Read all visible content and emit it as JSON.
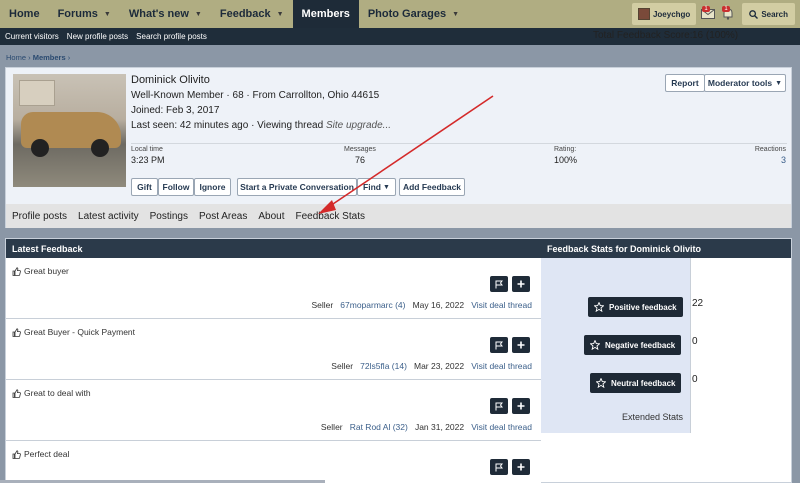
{
  "topnav": {
    "items": [
      {
        "label": "Home",
        "caret": false
      },
      {
        "label": "Forums",
        "caret": true
      },
      {
        "label": "What's new",
        "caret": true
      },
      {
        "label": "Feedback",
        "caret": true
      },
      {
        "label": "Members",
        "caret": false,
        "active": true
      },
      {
        "label": "Photo Garages",
        "caret": true
      }
    ],
    "user": "Joeychgo",
    "alerts": [
      "1",
      "1"
    ],
    "search_label": "Search"
  },
  "subnav": [
    "Current visitors",
    "New profile posts",
    "Search profile posts"
  ],
  "breadcrumb": [
    "Home",
    "Members"
  ],
  "profile": {
    "name": "Dominick Olivito",
    "line1": "Well-Known Member · 68 · From Carrollton, Ohio 44615",
    "joined": "Joined: Feb 3, 2017",
    "last_seen": "Last seen: 42 minutes ago · Viewing thread",
    "last_seen_extra": "Site upgrade...",
    "stats": [
      {
        "label": "Local time",
        "value": "3:23 PM"
      },
      {
        "label": "Messages",
        "value": "76"
      },
      {
        "label": "Rating:",
        "value": "100%"
      },
      {
        "label": "Reactions",
        "value": "3"
      }
    ],
    "buttons": [
      "Gift",
      "Follow",
      "Ignore",
      "Start a Private Conversation",
      "Find",
      "Add Feedback"
    ],
    "top_buttons": [
      "Report",
      "Moderator tools"
    ],
    "tabs": [
      "Profile posts",
      "Latest activity",
      "Postings",
      "Post Areas",
      "About",
      "Feedback Stats"
    ]
  },
  "feedback": {
    "header_left": "Latest Feedback",
    "header_right": "Feedback Stats for Dominick Olivito",
    "items": [
      {
        "title": "Great buyer",
        "role": "Seller",
        "user": "67moparmarc (4)",
        "date": "May 16, 2022",
        "link": "Visit deal thread"
      },
      {
        "title": "Great Buyer - Quick Payment",
        "role": "Seller",
        "user": "72ls5fla (14)",
        "date": "Mar 23, 2022",
        "link": "Visit deal thread"
      },
      {
        "title": "Great to deal with",
        "role": "Seller",
        "user": "Rat Rod Al (32)",
        "date": "Jan 31, 2022",
        "link": "Visit deal thread"
      },
      {
        "title": "Perfect deal",
        "role": "",
        "user": "",
        "date": "",
        "link": ""
      }
    ],
    "stats": {
      "total_label": "Total Feedback Score:",
      "total_value": "16 (100%)",
      "positive_label": "Positive feedback",
      "positive": "22",
      "negative_label": "Negative feedback",
      "negative": "0",
      "neutral_label": "Neutral feedback",
      "neutral": "0",
      "extended": "Extended Stats"
    }
  },
  "colors": {
    "nav_bg": "#b0ad82",
    "dark": "#1e2b38",
    "arrow": "#d42a2a"
  }
}
